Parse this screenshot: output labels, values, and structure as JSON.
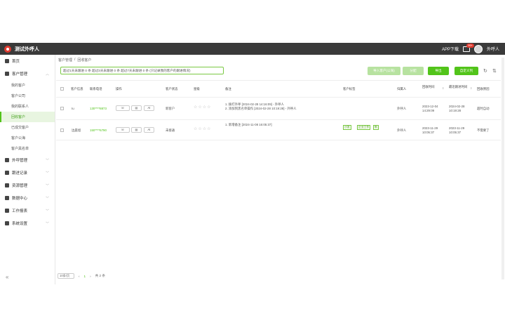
{
  "header": {
    "title": "测试外呼人",
    "app_download": "APP下载",
    "message_badge": "99+",
    "user_name": "外呼人"
  },
  "sidebar": {
    "home": "首页",
    "customer_mgmt": "客户管理",
    "sub_items": [
      "我的客户",
      "客户公司",
      "我的联系人",
      "回收客户",
      "已成交客户",
      "客户公海",
      "客户黑名单"
    ],
    "active_sub": "回收客户",
    "groups": [
      "外呼管理",
      "跟进记录",
      "资源管理",
      "数据中心",
      "工作报表",
      "系统设置"
    ],
    "collapse_icon": "«"
  },
  "breadcrumb": {
    "items": [
      "客户管理",
      "回收客户"
    ],
    "separator": "/"
  },
  "toolbar": {
    "filter_text": "超过1天未跟进 0 条  超过3天未跟进 0 条  超过7天未跟进 0 条  (只记录我的客户的跟进情况)",
    "btn_import_disabled": "导入客户(公海)",
    "btn_assign_disabled": "分配",
    "btn_add": "导出",
    "btn_columns": "自定义列",
    "refresh_icon": "refresh-icon",
    "settings_icon": "settings-icon"
  },
  "table": {
    "headers": [
      "客户信息",
      "联系电话",
      "操作",
      "客户状态",
      "星级",
      "备注",
      "客户标签",
      "归属人",
      "回收时间",
      "最近跟进时间",
      "回收原因"
    ],
    "op_labels": [
      "☏",
      "▤",
      "AI"
    ],
    "rows": [
      {
        "name": "Iu",
        "phone": "130****8873",
        "status": "新客户",
        "remarks": [
          "1. 拨打外呼 [2024-02-28 14:16:09] - 外呼人",
          "2. 添加到黑名单操作 [2024-02-28 10:19:28] - 外呼人"
        ],
        "tags": [],
        "owner": "外呼人",
        "recycle_time": "2023-12-04 14:29:09",
        "last_follow": "2024-02-28 10:19:28",
        "reason": "超时自动"
      },
      {
        "name": "边晨旭",
        "phone": "150****6790",
        "status": "未接通",
        "remarks": [
          "1. 新增备注 [2024-11-08 16:05:37]"
        ],
        "tags": [
          "沙发",
          "企业工作",
          "新"
        ],
        "owner": "外呼人",
        "recycle_time": "2023-11-29 10:05:37",
        "last_follow": "2023-11-29 10:05:37",
        "reason": "不需要了"
      }
    ]
  },
  "pagination": {
    "page_size": "10条/页",
    "prev": "‹",
    "current": "1",
    "next": "›",
    "total": "共 2 条"
  }
}
